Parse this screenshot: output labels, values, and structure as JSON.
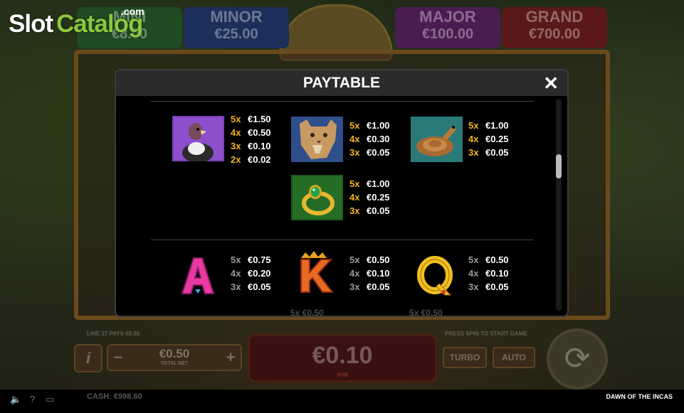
{
  "brand": {
    "slot": "Slot",
    "catalog": "Catalog",
    "com": ".com"
  },
  "jackpots": [
    {
      "label": "MINI",
      "value": "€8.00"
    },
    {
      "label": "MINOR",
      "value": "€25.00"
    },
    {
      "label": "MAJOR",
      "value": "€100.00"
    },
    {
      "label": "GRAND",
      "value": "€700.00"
    }
  ],
  "paytable": {
    "title": "PAYTABLE",
    "close": "✕",
    "premium": [
      {
        "symbol": "condor",
        "pays": [
          {
            "m": "5x",
            "v": "€1.50"
          },
          {
            "m": "4x",
            "v": "€0.50"
          },
          {
            "m": "3x",
            "v": "€0.10"
          },
          {
            "m": "2x",
            "v": "€0.02"
          }
        ]
      },
      {
        "symbol": "puma",
        "pays": [
          {
            "m": "5x",
            "v": "€1.00"
          },
          {
            "m": "4x",
            "v": "€0.30"
          },
          {
            "m": "3x",
            "v": "€0.05"
          }
        ]
      },
      {
        "symbol": "snake",
        "pays": [
          {
            "m": "5x",
            "v": "€1.00"
          },
          {
            "m": "4x",
            "v": "€0.25"
          },
          {
            "m": "3x",
            "v": "€0.05"
          }
        ]
      },
      {
        "symbol": "emerald-ring",
        "pays": [
          {
            "m": "5x",
            "v": "€1.00"
          },
          {
            "m": "4x",
            "v": "€0.25"
          },
          {
            "m": "3x",
            "v": "€0.05"
          }
        ]
      }
    ],
    "royals": [
      {
        "symbol": "A",
        "pays": [
          {
            "m": "5x",
            "v": "€0.75"
          },
          {
            "m": "4x",
            "v": "€0.20"
          },
          {
            "m": "3x",
            "v": "€0.05"
          }
        ]
      },
      {
        "symbol": "K",
        "pays": [
          {
            "m": "5x",
            "v": "€0.50"
          },
          {
            "m": "4x",
            "v": "€0.10"
          },
          {
            "m": "3x",
            "v": "€0.05"
          }
        ]
      },
      {
        "symbol": "Q",
        "pays": [
          {
            "m": "5x",
            "v": "€0.50"
          },
          {
            "m": "4x",
            "v": "€0.10"
          },
          {
            "m": "3x",
            "v": "€0.05"
          }
        ]
      }
    ],
    "next_row_partial": [
      {
        "m": "5x",
        "v": "€0.50"
      },
      {
        "m": "5x",
        "v": "€0.50"
      }
    ]
  },
  "bottom": {
    "line_info": "LINE 27 PAYS €0.05",
    "press_spin": "PRESS SPIN TO START GAME",
    "info": "i",
    "minus": "−",
    "plus": "+",
    "bet_value": "€0.50",
    "bet_label": "TOTAL BET",
    "win_value": "€0.10",
    "win_label": "WIN",
    "turbo": "TURBO",
    "auto": "AUTO",
    "spin_glyph": "⟳"
  },
  "status": {
    "sound": "🔈",
    "help": "?",
    "screen": "▭",
    "cash": "CASH: €998.60",
    "game_name": "DAWN OF THE INCAS"
  },
  "colors": {
    "multiplier_gold": "#f4b41a",
    "multiplier_grey": "#9a9a9a",
    "modal_header": "#2b2b2b"
  }
}
